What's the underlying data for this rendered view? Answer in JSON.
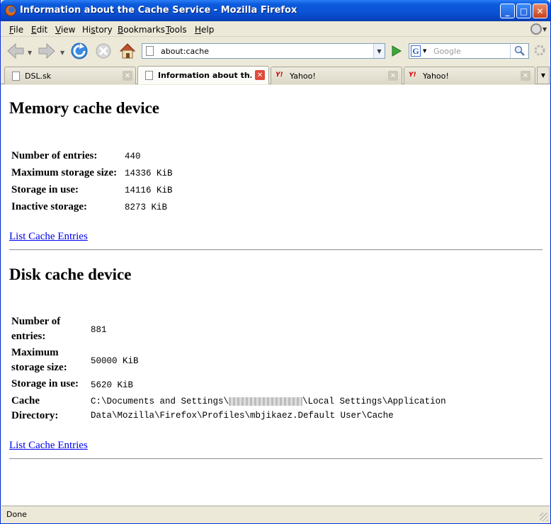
{
  "window": {
    "title": "Information about the Cache Service - Mozilla Firefox",
    "minimize_glyph": "_",
    "maximize_glyph": "□",
    "close_glyph": "✕"
  },
  "menu": [
    {
      "key": "F",
      "rest": "ile"
    },
    {
      "key": "E",
      "rest": "dit"
    },
    {
      "key": "V",
      "rest": "iew"
    },
    {
      "key": "",
      "pre": "Hi",
      "key2": "s",
      "rest": "tory"
    },
    {
      "key": "B",
      "rest": "ookmarks"
    },
    {
      "key": "T",
      "rest": "ools"
    },
    {
      "key": "H",
      "rest": "elp"
    }
  ],
  "navigation": {
    "url": "about:cache",
    "search_placeholder": "Google",
    "search_engine_glyph": "G"
  },
  "tabs": [
    {
      "label": "DSL.sk",
      "icon": "page-icon",
      "active": false
    },
    {
      "label": "Information about th...",
      "icon": "page-icon",
      "active": true
    },
    {
      "label": "Yahoo!",
      "icon": "yahoo-icon",
      "active": false
    },
    {
      "label": "Yahoo!",
      "icon": "yahoo-icon",
      "active": false
    }
  ],
  "yahoo_icon_text": "Y!",
  "memory": {
    "heading": "Memory cache device",
    "rows": [
      {
        "label": "Number of entries:",
        "value": "440"
      },
      {
        "label": "Maximum storage size:",
        "value": "14336 KiB"
      },
      {
        "label": "Storage in use:",
        "value": "14116 KiB"
      },
      {
        "label": "Inactive storage:",
        "value": "8273 KiB"
      }
    ],
    "link": "List Cache Entries"
  },
  "disk": {
    "heading": "Disk cache device",
    "rows": [
      {
        "label_l1": "Number of",
        "label_l2": "entries:",
        "value": "881"
      },
      {
        "label_l1": "Maximum",
        "label_l2": "storage size:",
        "value": "50000 KiB"
      },
      {
        "label_l1": "Storage in use:",
        "label_l2": "",
        "value": "5620 KiB"
      },
      {
        "label_l1": "Cache",
        "label_l2": "Directory:",
        "value_pre": "C:\\Documents and Settings\\",
        "value_post": "\\Local Settings\\Application",
        "value_l2": "Data\\Mozilla\\Firefox\\Profiles\\mbjikaez.Default User\\Cache"
      }
    ],
    "link": "List Cache Entries"
  },
  "status": {
    "text": "Done"
  },
  "colors": {
    "titlebar": "#0a52d5",
    "link": "#0000ee",
    "chrome": "#ece9d8"
  }
}
